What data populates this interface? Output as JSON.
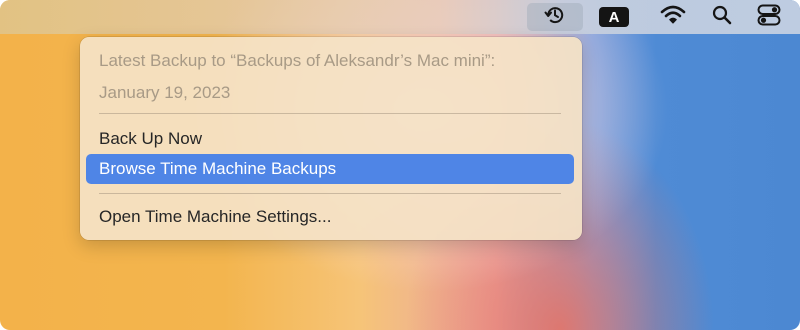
{
  "menubar": {
    "items": [
      {
        "icon": "time-machine-icon",
        "active": true
      },
      {
        "icon": "input-source-icon",
        "label": "A"
      },
      {
        "icon": "wifi-icon"
      },
      {
        "icon": "search-icon"
      },
      {
        "icon": "control-center-icon"
      }
    ]
  },
  "menu": {
    "header_line1": "Latest Backup to “Backups of Aleksandr’s Mac mini”:",
    "header_line2": "January 19, 2023",
    "back_up_now": "Back Up Now",
    "browse_backups": "Browse Time Machine Backups",
    "open_settings": "Open Time Machine Settings..."
  },
  "colors": {
    "highlight": "#4f85e6",
    "menu_background": "#f4e2c6"
  }
}
